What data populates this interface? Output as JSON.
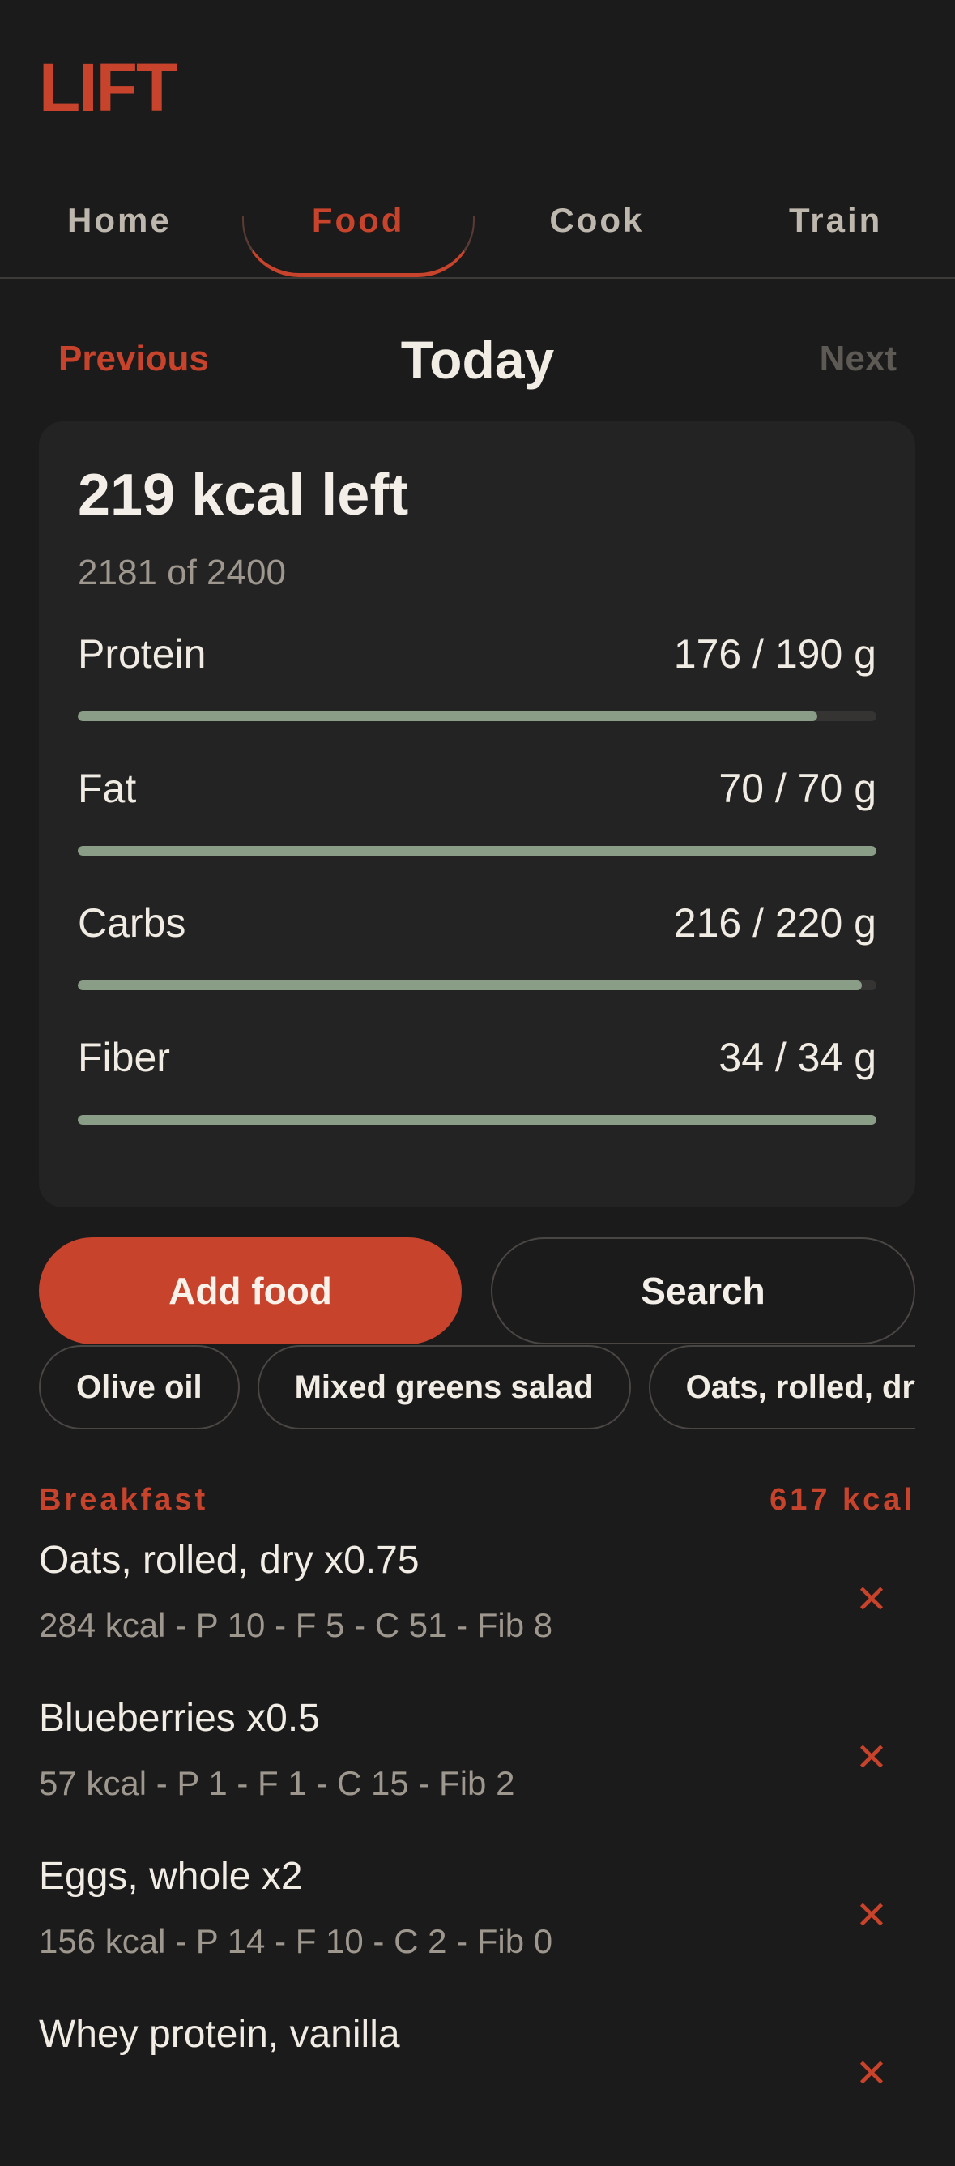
{
  "app": {
    "title": "LIFT"
  },
  "tabs": [
    {
      "label": "Home",
      "active": false
    },
    {
      "label": "Food",
      "active": true
    },
    {
      "label": "Cook",
      "active": false
    },
    {
      "label": "Train",
      "active": false
    }
  ],
  "day_nav": {
    "previous": "Previous",
    "current": "Today",
    "next": "Next"
  },
  "summary": {
    "kcal_left": "219 kcal left",
    "kcal_progress": "2181 of 2400",
    "macros": [
      {
        "name": "Protein",
        "value": "176 / 190 g",
        "current": 176,
        "target": 190
      },
      {
        "name": "Fat",
        "value": "70 / 70 g",
        "current": 70,
        "target": 70
      },
      {
        "name": "Carbs",
        "value": "216 / 220 g",
        "current": 216,
        "target": 220
      },
      {
        "name": "Fiber",
        "value": "34 / 34 g",
        "current": 34,
        "target": 34
      }
    ]
  },
  "actions": {
    "add_food": "Add food",
    "search": "Search"
  },
  "quick_chips": [
    "Olive oil",
    "Mixed greens salad",
    "Oats, rolled, dry"
  ],
  "meal": {
    "title": "Breakfast",
    "total": "617 kcal",
    "items": [
      {
        "name": "Oats, rolled, dry x0.75",
        "meta": "284 kcal - P 10 - F 5 - C 51 - Fib 8"
      },
      {
        "name": "Blueberries x0.5",
        "meta": "57 kcal - P 1 - F 1 - C 15 - Fib 2"
      },
      {
        "name": "Eggs, whole x2",
        "meta": "156 kcal - P 14 - F 10 - C 2 - Fib 0"
      },
      {
        "name": "Whey protein, vanilla",
        "meta": ""
      }
    ],
    "remove_glyph": "✕"
  },
  "colors": {
    "background": "#1c1b1b",
    "card": "#242323",
    "accent": "#c8432b",
    "progress_fill": "#8a9d86",
    "muted_text": "#9d978e"
  }
}
